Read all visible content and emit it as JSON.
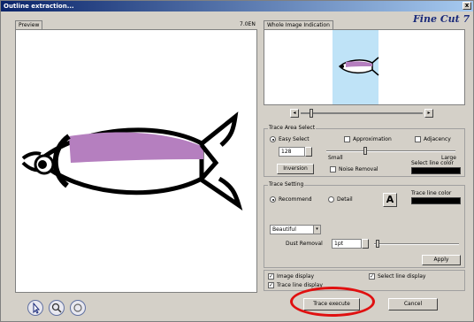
{
  "window": {
    "title": "Outline extraction...",
    "close": "x"
  },
  "tabs": {
    "preview": "Preview",
    "whole_image": "Whole Image Indication"
  },
  "ratio": "7.0EN",
  "logo": "Fine Cut 7",
  "scroll": {
    "left": "◂",
    "right": "▸"
  },
  "trace_area": {
    "legend": "Trace Area Select",
    "easy_select": "Easy Select",
    "approximation": "Approximation",
    "adjacency": "Adjacency",
    "value": "128",
    "small": "Small",
    "large": "Large",
    "select_line_color": "Select line color",
    "inversion": "Inversion",
    "noise_removal": "Noise Removal"
  },
  "trace_setting": {
    "legend": "Trace Setting",
    "recommend": "Recommend",
    "detail": "Detail",
    "trace_line_color": "Trace line color",
    "style": "Beautiful",
    "dust_removal_label": "Dust Removal",
    "dust_value": "1pt",
    "apply": "Apply"
  },
  "display": {
    "image_display": "Image display",
    "select_line_display": "Select line display",
    "trace_line_display": "Trace line display"
  },
  "footer": {
    "trace_execute": "Trace execute",
    "cancel": "Cancel"
  },
  "colors": {
    "fish_body": "#b57fbf",
    "sky": "#bfe3f7",
    "highlight": "#e01010"
  }
}
